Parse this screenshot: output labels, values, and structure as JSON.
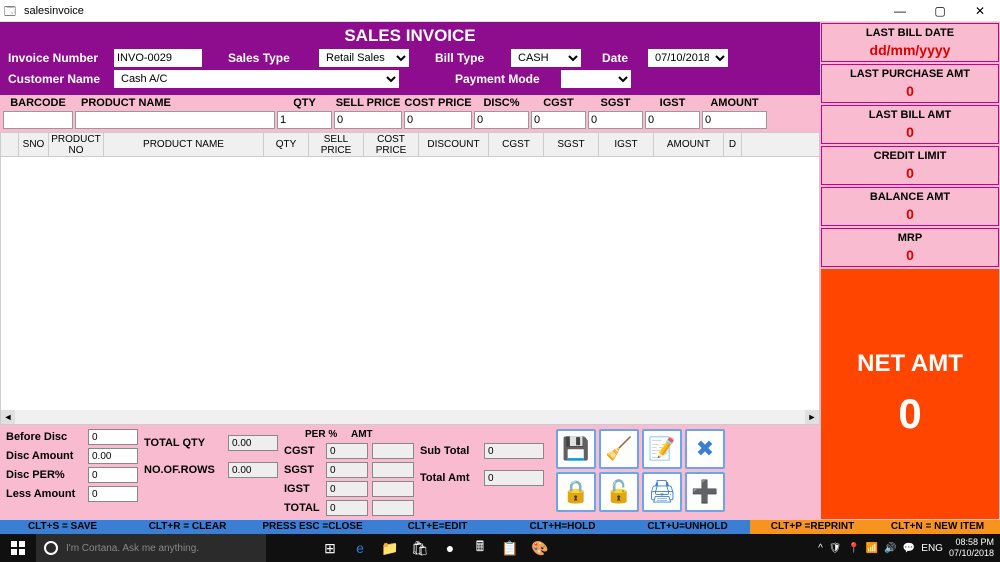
{
  "window": {
    "title": "salesinvoice"
  },
  "header": {
    "title": "SALES INVOICE",
    "invoice_number_label": "Invoice Number",
    "invoice_number": "INVO-0029",
    "sales_type_label": "Sales Type",
    "sales_type": "Retail Sales",
    "bill_type_label": "Bill Type",
    "bill_type": "CASH",
    "date_label": "Date",
    "date": "07/10/2018",
    "customer_name_label": "Customer Name",
    "customer_name": "Cash A/C",
    "payment_mode_label": "Payment Mode",
    "payment_mode": ""
  },
  "grid_labels": {
    "barcode": "BARCODE",
    "product_name": "PRODUCT NAME",
    "qty": "QTY",
    "sell_price": "SELL PRICE",
    "cost_price": "COST PRICE",
    "disc": "DISC%",
    "cgst": "CGST",
    "sgst": "SGST",
    "igst": "IGST",
    "amount": "AMOUNT"
  },
  "grid_inputs": {
    "barcode": "",
    "product_name": "",
    "qty": "1",
    "sell_price": "0",
    "cost_price": "0",
    "disc": "0",
    "cgst": "0",
    "sgst": "0",
    "igst": "0",
    "amount": "0"
  },
  "table_headers": [
    "SNO",
    "PRODUCT NO",
    "PRODUCT NAME",
    "QTY",
    "SELL PRICE",
    "COST PRICE",
    "DISCOUNT",
    "CGST",
    "SGST",
    "IGST",
    "AMOUNT",
    "D"
  ],
  "bottom": {
    "before_disc_label": "Before Disc",
    "before_disc": "0",
    "disc_amount_label": "Disc Amount",
    "disc_amount": "0.00",
    "disc_per_label": "Disc PER%",
    "disc_per": "0",
    "less_amount_label": "Less Amount",
    "less_amount": "0",
    "total_qty_label": "TOTAL QTY",
    "total_qty": "0.00",
    "no_of_rows_label": "NO.OF.ROWS",
    "no_of_rows": "0.00",
    "per_label": "PER %",
    "amt_label": "AMT",
    "cgst_label": "CGST",
    "cgst_per": "0",
    "cgst_amt": "",
    "sgst_label": "SGST",
    "sgst_per": "0",
    "sgst_amt": "",
    "igst_label": "IGST",
    "igst_per": "0",
    "igst_amt": "",
    "total_label": "TOTAL",
    "total_per": "0",
    "total_amt": "",
    "sub_total_label": "Sub Total",
    "sub_total": "0",
    "total_amt_label2": "Total Amt",
    "total_amt2": "0"
  },
  "right_panel": {
    "last_bill_date_label": "LAST BILL DATE",
    "last_bill_date": "dd/mm/yyyy",
    "last_purchase_amt_label": "LAST PURCHASE AMT",
    "last_purchase_amt": "0",
    "last_bill_amt_label": "LAST BILL AMT",
    "last_bill_amt": "0",
    "credit_limit_label": "CREDIT LIMIT",
    "credit_limit": "0",
    "balance_amt_label": "BALANCE AMT",
    "balance_amt": "0",
    "mrp_label": "MRP",
    "mrp": "0",
    "net_amt_label": "NET AMT",
    "net_amt": "0"
  },
  "shortcuts": {
    "save": "CLT+S = SAVE",
    "clear": "CLT+R = CLEAR",
    "close": "PRESS ESC =CLOSE",
    "edit": "CLT+E=EDIT",
    "hold": "CLT+H=HOLD",
    "unhold": "CLT+U=UNHOLD",
    "reprint": "CLT+P =REPRINT",
    "newitem": "CLT+N = NEW ITEM"
  },
  "taskbar": {
    "cortana_placeholder": "I'm Cortana. Ask me anything.",
    "lang": "ENG",
    "time": "08:58 PM",
    "date": "07/10/2018"
  }
}
